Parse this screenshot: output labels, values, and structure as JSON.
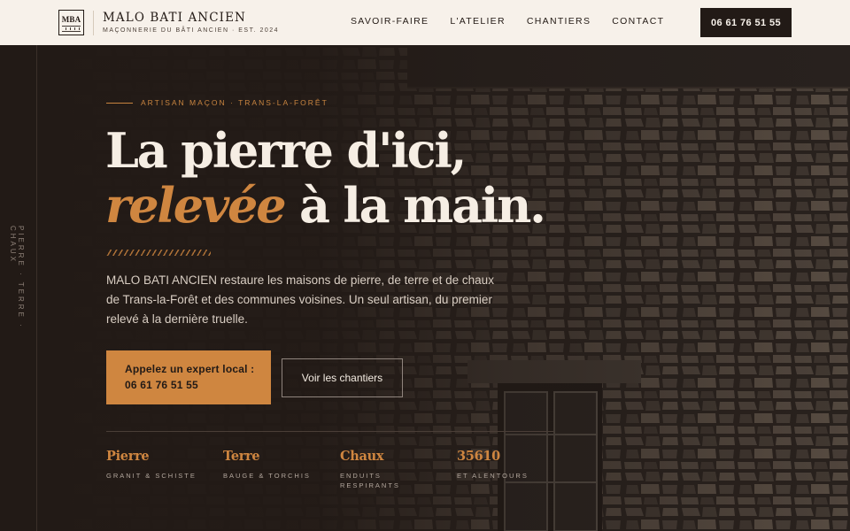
{
  "header": {
    "logo_text": "MBA",
    "brand_name": "MALO BATI ANCIEN",
    "tagline": "MAÇONNERIE DU BÂTI ANCIEN · EST. 2024",
    "nav": [
      {
        "label": "SAVOIR-FAIRE"
      },
      {
        "label": "L'ATELIER"
      },
      {
        "label": "CHANTIERS"
      },
      {
        "label": "CONTACT"
      }
    ],
    "phone": "06 61 76 51 55"
  },
  "hero": {
    "side_text": "PIERRE · TERRE · CHAUX",
    "eyebrow": "ARTISAN MAÇON · TRANS-LA-FORÊT",
    "headline_line1": "La pierre d'ici,",
    "headline_accent": "relevée",
    "headline_line2_rest": " à la main.",
    "lead": "MALO BATI ANCIEN restaure les maisons de pierre, de terre et de chaux de Trans-la-Forêt et des communes voisines. Un seul artisan, du premier relevé à la dernière truelle.",
    "cta_primary_line1": "Appelez un expert local :",
    "cta_primary_line2": "06 61 76 51 55",
    "cta_secondary": "Voir les chantiers",
    "features": [
      {
        "title": "Pierre",
        "subtitle": "GRANIT & SCHISTE"
      },
      {
        "title": "Terre",
        "subtitle": "BAUGE & TORCHIS"
      },
      {
        "title": "Chaux",
        "subtitle": "ENDUITS RESPIRANTS"
      },
      {
        "title": "35610",
        "subtitle": "ET ALENTOURS"
      }
    ]
  },
  "colors": {
    "accent": "#cf8640",
    "dark": "#221a16",
    "header_bg": "#f7f1ea"
  }
}
